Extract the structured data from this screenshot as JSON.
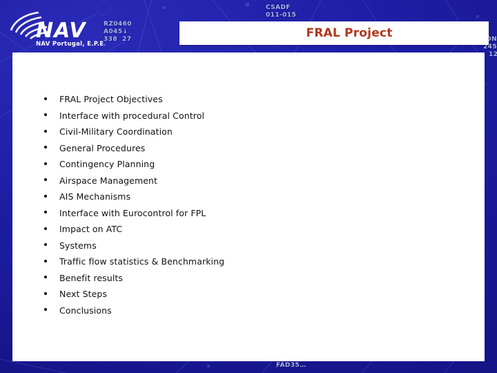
{
  "slide": {
    "title": "FRAL Project",
    "title_color": "#b0381c",
    "background_color": "#1d1da4",
    "panel_color": "#ffffff"
  },
  "logo": {
    "name": "NAV Portugal logo",
    "wordmark": "NAV",
    "subtitle": "NAV Portugal, E.P.E."
  },
  "background_labels": {
    "flight_block_1": "RZ0460\nA045↓\n338  27",
    "flight_block_2": "CSADF\n011-015",
    "flight_block_3": "FAD35…",
    "right_edge_1": "ON",
    "right_edge_2": "245",
    "right_edge_3": "12"
  },
  "agenda": {
    "items": [
      {
        "label": "FRAL Project Objectives"
      },
      {
        "label": "Interface with procedural Control"
      },
      {
        "label": "Civil-Military Coordination"
      },
      {
        "label": "General Procedures"
      },
      {
        "label": "Contingency Planning"
      },
      {
        "label": "Airspace Management"
      },
      {
        "label": "AIS Mechanisms"
      },
      {
        "label": "Interface with Eurocontrol for FPL"
      },
      {
        "label": "Impact on ATC"
      },
      {
        "label": "Systems"
      },
      {
        "label": "Traffic flow statistics & Benchmarking"
      },
      {
        "label": "Benefit results"
      },
      {
        "label": "Next Steps"
      },
      {
        "label": "Conclusions"
      }
    ]
  }
}
